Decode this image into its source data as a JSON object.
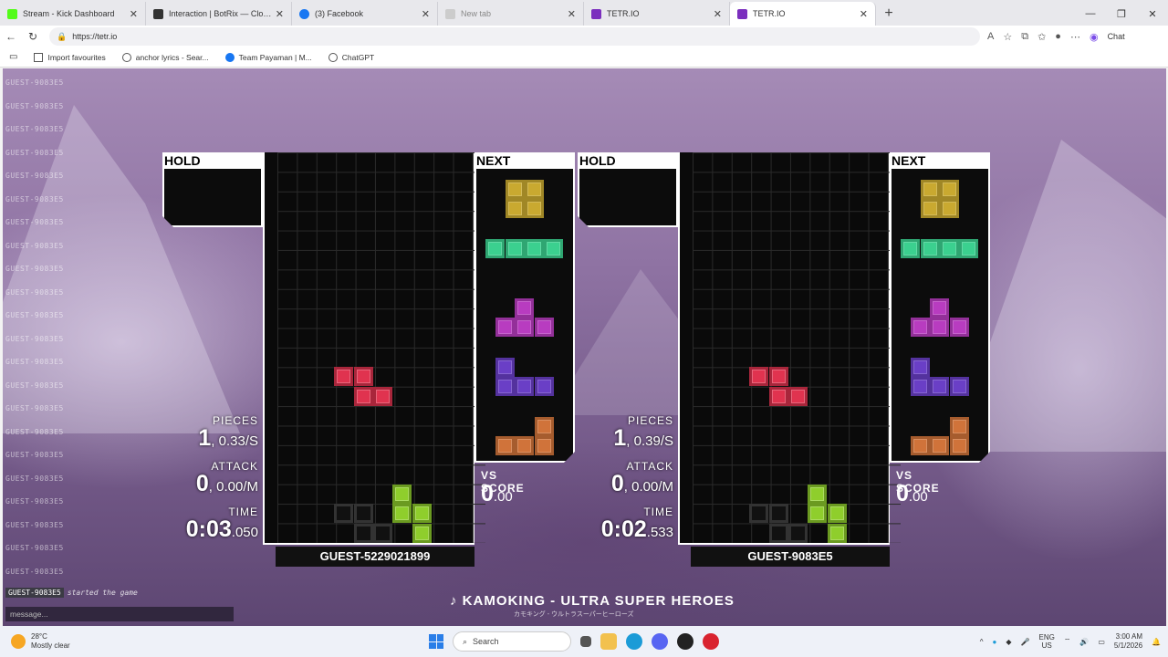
{
  "browser": {
    "tabs": [
      {
        "title": "Stream - Kick Dashboard",
        "color": "#53fc18"
      },
      {
        "title": "Interaction | BotRix — Cloud Streaming",
        "color": "#333333"
      },
      {
        "title": "(3) Facebook",
        "color": "#1877f2"
      },
      {
        "title": "New tab",
        "color": "#bbbbbb"
      },
      {
        "title": "TETR.IO",
        "color": "#7b2fbe"
      },
      {
        "title": "TETR.IO",
        "color": "#7b2fbe"
      }
    ],
    "url": "https://tetr.io",
    "chat_button": "Chat",
    "favorites": [
      {
        "label": "Import favourites"
      },
      {
        "label": "anchor lyrics - Sear..."
      },
      {
        "label": "Team Payaman | M..."
      },
      {
        "label": "ChatGPT"
      }
    ]
  },
  "game": {
    "chat_lines": [
      "GUEST-9083E5",
      "GUEST-9083E5",
      "GUEST-9083E5",
      "GUEST-9083E5",
      "GUEST-9083E5",
      "GUEST-9083E5",
      "GUEST-9083E5",
      "GUEST-9083E5",
      "GUEST-9083E5",
      "GUEST-9083E5",
      "GUEST-9083E5",
      "GUEST-9083E5",
      "GUEST-9083E5",
      "GUEST-9083E5",
      "GUEST-9083E5",
      "GUEST-9083E5",
      "GUEST-9083E5",
      "GUEST-9083E5",
      "GUEST-9083E5",
      "GUEST-9083E5",
      "GUEST-9083E5",
      "GUEST-9083E5"
    ],
    "last_chat_user": "GUEST-9083E5",
    "last_chat_msg": "started the game",
    "message_placeholder": "message...",
    "song": "♪ KAMOKING - ULTRA SUPER HEROES",
    "song_sub": "カモキング - ウルトラスーパーヒーローズ",
    "labels": {
      "hold": "HOLD",
      "next": "NEXT",
      "pieces": "PIECES",
      "attack": "ATTACK",
      "time": "TIME",
      "vs_score": "VS SCORE"
    },
    "players": [
      {
        "name": "GUEST-5229021899",
        "pieces": "1",
        "pps": "0.33/S",
        "attack": "0",
        "apm": "0.00/M",
        "time_main": "0:03",
        "time_ms": ".050",
        "vs_int": "0",
        "vs_dec": ".00"
      },
      {
        "name": "GUEST-9083E5",
        "pieces": "1",
        "pps": "0.39/S",
        "attack": "0",
        "apm": "0.00/M",
        "time_main": "0:02",
        "time_ms": ".533",
        "vs_int": "0",
        "vs_dec": ".00"
      }
    ],
    "next_queue": [
      "O",
      "I",
      "T",
      "J",
      "L"
    ],
    "piece_colors": {
      "O": "#c9a930",
      "I": "#3bd08f",
      "T": "#b83cc0",
      "J": "#6a3fc6",
      "L": "#d0733a",
      "Z": "#e0334f",
      "S": "#8fce2c"
    }
  },
  "taskbar": {
    "temp": "28°C",
    "weather": "Mostly clear",
    "search": "Search",
    "lang1": "ENG",
    "lang2": "US",
    "time": "3:00 AM",
    "date": "5/1/2026"
  }
}
